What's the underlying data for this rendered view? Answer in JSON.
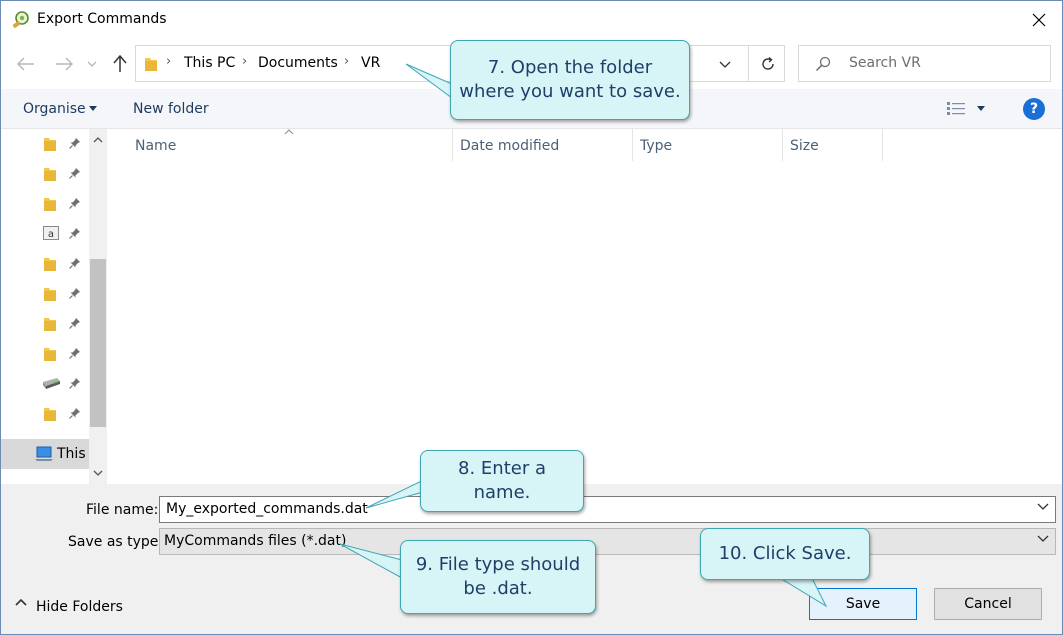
{
  "window": {
    "title": "Export Commands"
  },
  "nav": {
    "breadcrumbs": [
      "This PC",
      "Documents",
      "VR"
    ]
  },
  "search": {
    "placeholder": "Search VR"
  },
  "toolbar": {
    "organise_label": "Organise",
    "new_folder_label": "New folder",
    "help_label": "?"
  },
  "file_list": {
    "columns": [
      "Name",
      "Date modified",
      "Type",
      "Size"
    ]
  },
  "nav_pane": {
    "selected_label": "This",
    "items": [
      {
        "icon": "folder-icon"
      },
      {
        "icon": "folder-icon"
      },
      {
        "icon": "folder-icon"
      },
      {
        "icon": "document-icon"
      },
      {
        "icon": "folder-icon"
      },
      {
        "icon": "folder-icon"
      },
      {
        "icon": "folder-icon"
      },
      {
        "icon": "folder-icon"
      },
      {
        "icon": "drive-icon"
      },
      {
        "icon": "folder-icon"
      }
    ]
  },
  "form": {
    "file_name_label": "File name:",
    "file_name_value": "My_exported_commands.dat",
    "save_type_label": "Save as type:",
    "save_type_value": "MyCommands files (*.dat)",
    "hide_folders_label": "Hide Folders",
    "save_label": "Save",
    "cancel_label": "Cancel"
  },
  "callouts": {
    "step7": "7. Open the folder where you want to save.",
    "step8": "8. Enter a name.",
    "step9": "9. File type should be .dat.",
    "step10": "10. Click Save."
  },
  "colors": {
    "callout_fill": "#d7f4f7",
    "callout_border": "#3fa7b4",
    "callout_text": "#1f3f68",
    "accent": "#0078d7",
    "folder": "#f3c74a"
  }
}
